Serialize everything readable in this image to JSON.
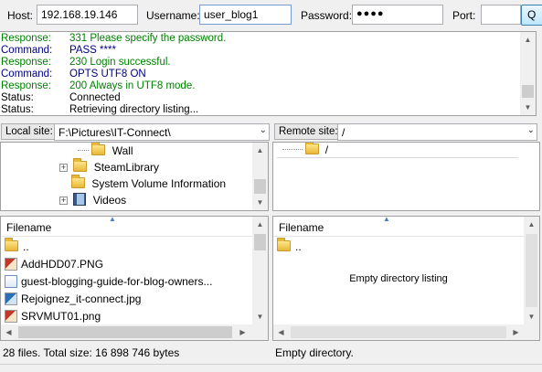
{
  "quickconnect": {
    "host_label": "Host:",
    "host_value": "192.168.19.146",
    "username_label": "Username:",
    "username_value": "user_blog1",
    "password_label": "Password:",
    "password_value": "●●●●",
    "port_label": "Port:",
    "port_value": "",
    "connect_button": "Q"
  },
  "message_log": [
    {
      "type": "Response:",
      "message": "331 Please specify the password.",
      "kind": "response"
    },
    {
      "type": "Command:",
      "message": "PASS ****",
      "kind": "command"
    },
    {
      "type": "Response:",
      "message": "230 Login successful.",
      "kind": "response"
    },
    {
      "type": "Command:",
      "message": "OPTS UTF8 ON",
      "kind": "command"
    },
    {
      "type": "Response:",
      "message": "200 Always in UTF8 mode.",
      "kind": "response"
    },
    {
      "type": "Status:",
      "message": "Connected",
      "kind": "status"
    },
    {
      "type": "Status:",
      "message": "Retrieving directory listing...",
      "kind": "status"
    }
  ],
  "local": {
    "site_label": "Local site:",
    "path": "F:\\Pictures\\IT-Connect\\",
    "tree": [
      {
        "name": "Wall",
        "expandable": false,
        "icon": "folder-icon"
      },
      {
        "name": "SteamLibrary",
        "expandable": true,
        "icon": "folder-icon"
      },
      {
        "name": "System Volume Information",
        "expandable": false,
        "icon": "folder-icon"
      },
      {
        "name": "Videos",
        "expandable": true,
        "icon": "video-icon"
      }
    ],
    "column_filename": "Filename",
    "files": [
      {
        "name": "..",
        "icon": "folder-icon"
      },
      {
        "name": "AddHDD07.PNG",
        "icon": "png-file-icon"
      },
      {
        "name": "guest-blogging-guide-for-blog-owners...",
        "icon": "html-file-icon"
      },
      {
        "name": "Rejoignez_it-connect.jpg",
        "icon": "jpg-file-icon"
      },
      {
        "name": "SRVMUT01.png",
        "icon": "png-file-icon"
      }
    ],
    "status": "28 files. Total size: 16 898 746 bytes"
  },
  "remote": {
    "site_label": "Remote site:",
    "path": "/",
    "tree_root": "/",
    "column_filename": "Filename",
    "parent_entry": "..",
    "empty_message": "Empty directory listing",
    "status": "Empty directory."
  },
  "colors": {
    "response": "#008000",
    "command": "#000080",
    "status": "#000000",
    "accent_border": "#7a9cd3"
  }
}
